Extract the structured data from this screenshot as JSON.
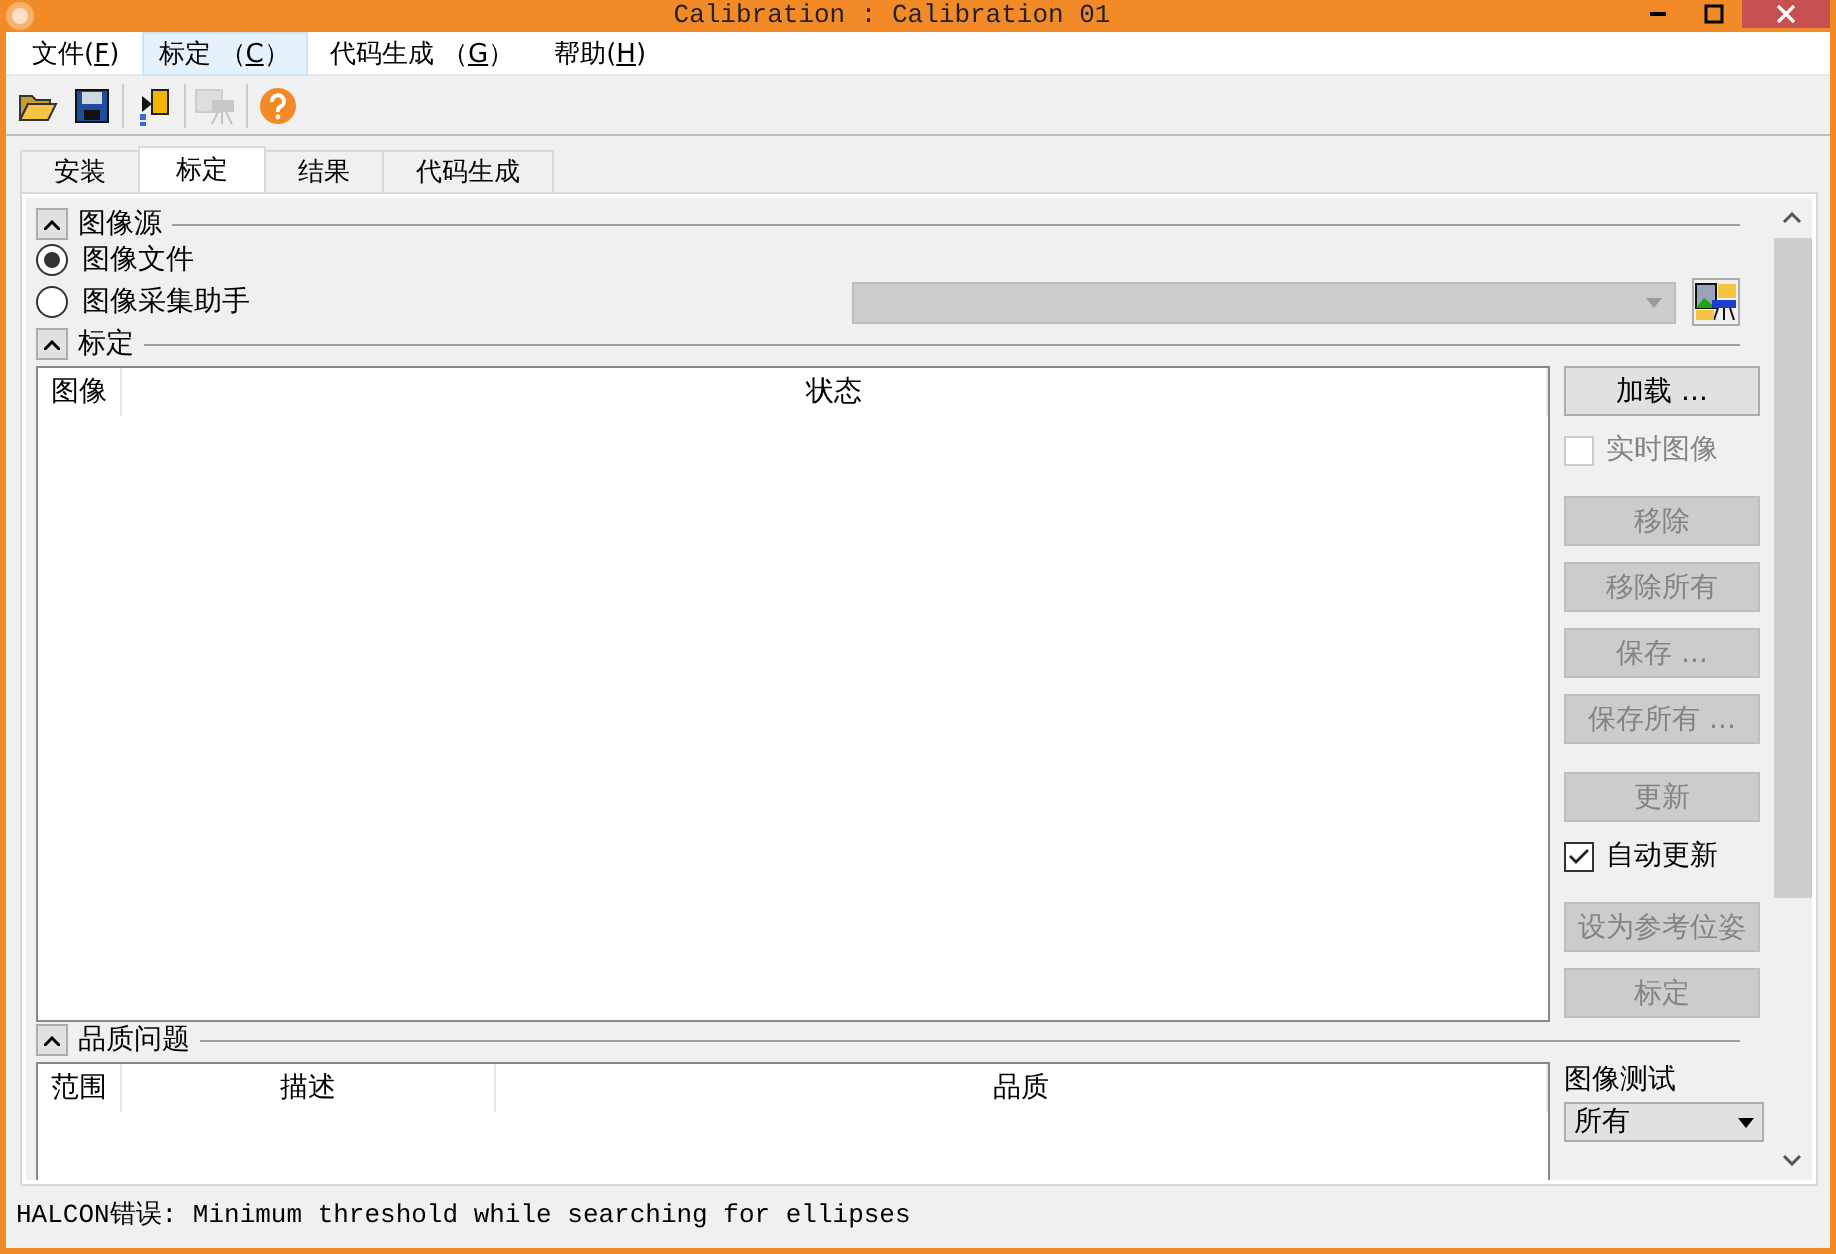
{
  "window": {
    "title": "Calibration : Calibration 01"
  },
  "menu": [
    {
      "prefix": "文件(",
      "key": "F",
      "suffix": ")",
      "selected": false
    },
    {
      "prefix": "标定 （",
      "key": "C",
      "suffix": "）",
      "selected": true
    },
    {
      "prefix": "代码生成 （",
      "key": "G",
      "suffix": "）",
      "selected": false
    },
    {
      "prefix": "帮助(",
      "key": "H",
      "suffix": ")",
      "selected": false
    }
  ],
  "toolbar": [
    {
      "kind": "open",
      "disabled": false
    },
    {
      "kind": "save",
      "disabled": false
    },
    {
      "kind": "export",
      "disabled": false
    },
    {
      "kind": "camera",
      "disabled": true
    },
    {
      "kind": "help",
      "disabled": false
    }
  ],
  "tabs": [
    {
      "label": "安装",
      "selected": false
    },
    {
      "label": "标定",
      "selected": true
    },
    {
      "label": "结果",
      "selected": false
    },
    {
      "label": "代码生成",
      "selected": false
    }
  ],
  "image_source": {
    "title": "图像源",
    "options": [
      {
        "label": "图像文件",
        "selected": true
      },
      {
        "label": "图像采集助手",
        "selected": false
      }
    ],
    "assistant_select": {
      "disabled": true
    }
  },
  "calibration": {
    "title": "标定",
    "columns": [
      "图像",
      "状态"
    ],
    "groups": [
      [
        {
          "kind": "button",
          "label": "加载 ...",
          "disabled": false
        },
        {
          "kind": "checkbox",
          "label": "实时图像",
          "checked": false,
          "disabled": true
        }
      ],
      [
        {
          "kind": "button",
          "label": "移除",
          "disabled": true
        },
        {
          "kind": "button",
          "label": "移除所有",
          "disabled": true
        },
        {
          "kind": "button",
          "label": "保存 ...",
          "disabled": true
        },
        {
          "kind": "button",
          "label": "保存所有 ...",
          "disabled": true
        }
      ],
      [
        {
          "kind": "button",
          "label": "更新",
          "disabled": true
        },
        {
          "kind": "checkbox",
          "label": "自动更新",
          "checked": true,
          "disabled": false
        }
      ],
      [
        {
          "kind": "button",
          "label": "设为参考位姿",
          "disabled": true
        },
        {
          "kind": "button",
          "label": "标定",
          "disabled": true
        }
      ]
    ]
  },
  "quality": {
    "title": "品质问题",
    "columns": [
      "范围",
      "描述",
      "品质"
    ],
    "test_label": "图像测试",
    "test_select": "所有"
  },
  "status_bar": "HALCON错误: Minimum threshold while searching for ellipses"
}
